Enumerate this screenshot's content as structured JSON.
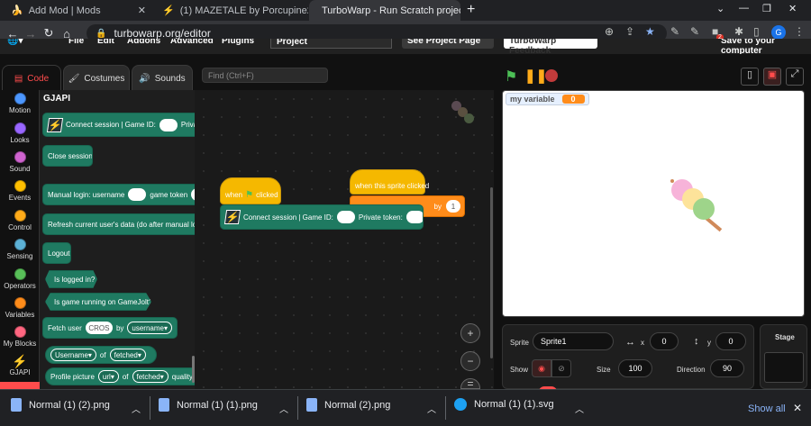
{
  "browser": {
    "tabs": [
      {
        "title": "Add Mod | Mods",
        "icon": "banana-icon"
      },
      {
        "title": "(1) MAZETALE by Porcupine2009",
        "icon": "gamejolt-icon"
      },
      {
        "title": "TurboWarp - Run Scratch project",
        "icon": "turbowarp-icon"
      }
    ],
    "new_tab": "+",
    "url": "turbowarp.org/editor",
    "profile": "G",
    "badge": "2"
  },
  "menu": {
    "items": [
      "File",
      "Edit",
      "Addons",
      "Advanced",
      "Plugins"
    ],
    "project_title": "Project",
    "see_project_page": "See Project Page",
    "feedback": "TurboWarp Feedback",
    "save": "Save to your computer"
  },
  "editor_tabs": {
    "code": "Code",
    "costumes": "Costumes",
    "sounds": "Sounds"
  },
  "categories": [
    {
      "label": "Motion",
      "color": "#4c97ff"
    },
    {
      "label": "Looks",
      "color": "#9966ff"
    },
    {
      "label": "Sound",
      "color": "#cf63cf"
    },
    {
      "label": "Events",
      "color": "#ffbf00"
    },
    {
      "label": "Control",
      "color": "#ffab19"
    },
    {
      "label": "Sensing",
      "color": "#5cb1d6"
    },
    {
      "label": "Operators",
      "color": "#59c059"
    },
    {
      "label": "Variables",
      "color": "#ff8c1a"
    },
    {
      "label": "My Blocks",
      "color": "#ff6680"
    },
    {
      "label": "GJAPI",
      "color": "#1f7a61"
    }
  ],
  "palette": {
    "heading": "GJAPI",
    "connect": "Connect session | Game ID:",
    "connect_private": "Private",
    "close_session": "Close session",
    "manual_login": "Manual login: username",
    "manual_login_token": "game token",
    "refresh": "Refresh current user's data (do after manual login)",
    "logout": "Logout",
    "is_logged_in": "Is logged in?",
    "is_running": "Is game running on GameJolt?",
    "fetch_user": "Fetch user",
    "fetch_user_value": "CROS",
    "fetch_by": "by",
    "fetch_by_option": "username",
    "username_opt": "Username",
    "of": "of",
    "fetched": "fetched",
    "profile_picture": "Profile picture",
    "url_opt": "url",
    "of2": "of",
    "fetched2": "fetched",
    "quality": "quality"
  },
  "find_placeholder": "Find (Ctrl+F)",
  "workspace": {
    "when_flag": "when",
    "clicked": "clicked",
    "connect": "Connect session | Game ID:",
    "private_token": "Private token:",
    "sprite_clicked": "when this sprite clicked",
    "by": "by",
    "by_value": "1"
  },
  "stage": {
    "variable_name": "my variable",
    "variable_value": "0"
  },
  "sprite_info": {
    "sprite_label": "Sprite",
    "sprite_name": "Sprite1",
    "x_label": "x",
    "x": "0",
    "y_label": "y",
    "y": "0",
    "show_label": "Show",
    "size_label": "Size",
    "size": "100",
    "direction_label": "Direction",
    "direction": "90",
    "stage_label": "Stage"
  },
  "downloads": {
    "files": [
      {
        "name": "Normal (1) (2).png"
      },
      {
        "name": "Normal (1) (1).png"
      },
      {
        "name": "Normal (2).png"
      },
      {
        "name": "Normal (1) (1).svg"
      }
    ],
    "show_all": "Show all"
  }
}
